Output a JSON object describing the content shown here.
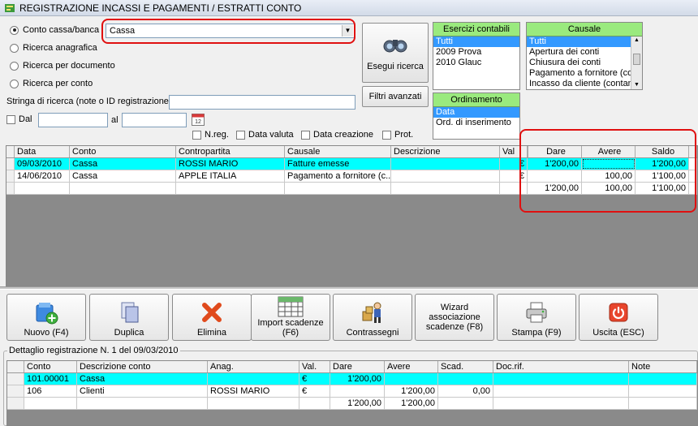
{
  "window": {
    "title": "REGISTRAZIONE INCASSI E PAGAMENTI / ESTRATTI CONTO"
  },
  "search": {
    "radio_conto": "Conto cassa/banca",
    "radio_anagrafica": "Ricerca anagrafica",
    "radio_documento": "Ricerca per documento",
    "radio_conto2": "Ricerca per conto",
    "conto_value": "Cassa",
    "stringa_label": "Stringa di ricerca (note o ID registrazione)",
    "stringa_value": "",
    "dal_label": "Dal",
    "al_label": "al",
    "dal_value": "",
    "al_value": "",
    "esegui_label": "Esegui ricerca",
    "filtri_label": "Filtri avanzati",
    "nreg_label": "N.reg.",
    "data_valuta_label": "Data valuta",
    "data_creazione_label": "Data creazione",
    "prot_label": "Prot."
  },
  "esercizi": {
    "header": "Esercizi contabili",
    "items": [
      "Tutti",
      "2009 Prova",
      "2010 Glauc"
    ]
  },
  "causale": {
    "header": "Causale",
    "items": [
      "Tutti",
      "Apertura dei conti",
      "Chiusura dei conti",
      "Pagamento a fornitore (co",
      "Incasso da cliente (contan"
    ]
  },
  "ordinamento": {
    "header": "Ordinamento",
    "items": [
      "Data",
      "Ord. di inserimento"
    ]
  },
  "main_grid": {
    "headers": [
      "Data",
      "Conto",
      "Contropartita",
      "Causale",
      "Descrizione",
      "Val",
      "Dare",
      "Avere",
      "Saldo"
    ],
    "rows": [
      [
        "09/03/2010",
        "Cassa",
        "ROSSI MARIO",
        "Fatture emesse",
        "",
        "€",
        "1'200,00",
        "",
        "1'200,00"
      ],
      [
        "14/06/2010",
        "Cassa",
        "APPLE ITALIA",
        "Pagamento a fornitore (c...",
        "",
        "€",
        "",
        "100,00",
        "1'100,00"
      ]
    ],
    "totals": {
      "dare": "1'200,00",
      "avere": "100,00",
      "saldo": "1'100,00"
    }
  },
  "toolbar": {
    "nuovo": "Nuovo (F4)",
    "duplica": "Duplica",
    "elimina": "Elimina",
    "import": "Import scadenze (F6)",
    "contrassegni": "Contrassegni",
    "wizard": "Wizard associazione scadenze (F8)",
    "stampa": "Stampa (F9)",
    "uscita": "Uscita (ESC)"
  },
  "detail": {
    "title": "Dettaglio registrazione N. 1 del 09/03/2010",
    "headers": [
      "Conto",
      "Descrizione conto",
      "Anag.",
      "Val.",
      "Dare",
      "Avere",
      "Scad.",
      "Doc.rif.",
      "Note"
    ],
    "rows": [
      [
        "101.00001",
        "Cassa",
        "",
        "€",
        "1'200,00",
        "",
        "",
        "",
        ""
      ],
      [
        "106",
        "Clienti",
        "ROSSI MARIO",
        "€",
        "",
        "1'200,00",
        "0,00",
        "",
        ""
      ]
    ],
    "totals": {
      "dare": "1'200,00",
      "avere": "1'200,00"
    }
  },
  "colors": {
    "highlight_row": "#00ffff",
    "panel_header": "#9aea7e",
    "selection": "#3399ff",
    "annotation": "#e01010"
  }
}
